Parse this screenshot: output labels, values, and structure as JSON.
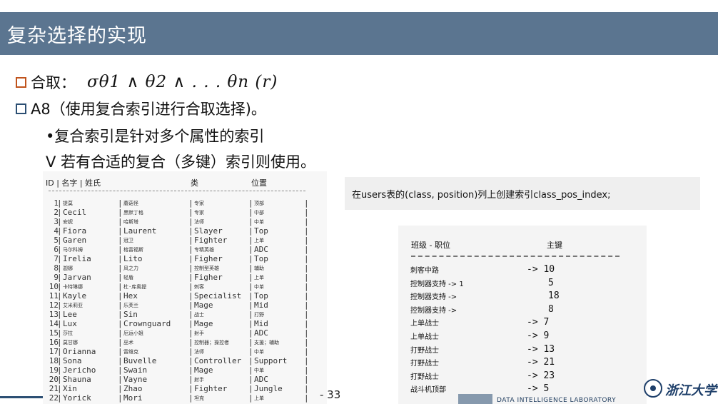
{
  "slide": {
    "title": "复杂选择的实现",
    "bullet1_label": "合取：",
    "bullet1_formula": "σθ1 ∧ θ2 ∧ . . . θn (r)",
    "bullet2": "A8（使用复合索引进行合取选择)。",
    "sub1": "•复合索引是针对多个属性的索引",
    "sub2": "V 若有合适的复合（多键）索引则使用。",
    "page_number": "- 33",
    "lab_name": "DATA INTELLIGENCE LABORATORY",
    "univ_name": "浙江大学"
  },
  "table": {
    "header": [
      "ID | 名字 | 姓氏",
      "类",
      "位置"
    ],
    "rows": [
      [
        "1",
        "提莫",
        "蘑菇怪",
        "专家",
        "顶部"
      ],
      [
        "2",
        "Cecil",
        "黑默丁格",
        "专家",
        "中部"
      ],
      [
        "3",
        "安妮",
        "哈斯塔",
        "法师",
        "中单"
      ],
      [
        "4",
        "Fiora",
        "Laurent",
        "Slayer",
        "Top"
      ],
      [
        "5",
        "Garen",
        "冠卫",
        "Fighter",
        "上单"
      ],
      [
        "6",
        "马尔科姆",
        "格雷福斯",
        "专精英雄",
        "ADC"
      ],
      [
        "7",
        "Irelia",
        "Lito",
        "Figher",
        "Top"
      ],
      [
        "8",
        "迦娜",
        "风之力",
        "控制型英雄",
        "辅助"
      ],
      [
        "9",
        "Jarvan",
        "轻盾",
        "Figher",
        "上单"
      ],
      [
        "10",
        "卡特琳娜",
        "杜·库奥提",
        "刺客",
        "中单"
      ],
      [
        "11",
        "Kayle",
        "Hex",
        "Specialist",
        "Top"
      ],
      [
        "12",
        "艾米莉亚",
        "乐芙兰",
        "Mage",
        "Mid"
      ],
      [
        "13",
        "Lee",
        "Sin",
        "战士",
        "打野"
      ],
      [
        "14",
        "Lux",
        "Crownguard",
        "Mage",
        "Mid"
      ],
      [
        "15",
        "莎拉",
        "厄运小姐",
        "射手",
        "ADC"
      ],
      [
        "16",
        "莫甘娜",
        "巫术",
        "控制器；操控者",
        "支援；辅助"
      ],
      [
        "17",
        "Orianna",
        "雷维克",
        "法师",
        "中单"
      ],
      [
        "18",
        "Sona",
        "Buvelle",
        "Controller",
        "Support"
      ],
      [
        "19",
        "Jericho",
        "Swain",
        "Mage",
        "中单"
      ],
      [
        "20",
        "Shauna",
        "Vayne",
        "射手",
        "ADC"
      ],
      [
        "21",
        "Xin",
        "Zhao",
        "Fighter",
        "Jungle"
      ],
      [
        "22",
        "Yorick",
        "Mori",
        "坦克",
        "上单"
      ]
    ]
  },
  "info": {
    "text": "在users表的(class, position)列上创建索引class_pos_index;"
  },
  "index_table": {
    "header": [
      "班级 - 职位",
      "主键"
    ],
    "rows": [
      [
        "刺客中路",
        "-> 10"
      ],
      [
        "控制器支持 -> 1",
        "5"
      ],
      [
        "控制器支持 ->",
        "18"
      ],
      [
        "控制器支持 ->",
        "8"
      ],
      [
        "上单战士",
        "-> 7"
      ],
      [
        "上单战士",
        "-> 9"
      ],
      [
        "打野战士",
        "-> 13"
      ],
      [
        "打野战士",
        "-> 21"
      ],
      [
        "打野战士",
        "-> 23"
      ],
      [
        "战斗机顶部",
        "-> 5"
      ]
    ]
  }
}
